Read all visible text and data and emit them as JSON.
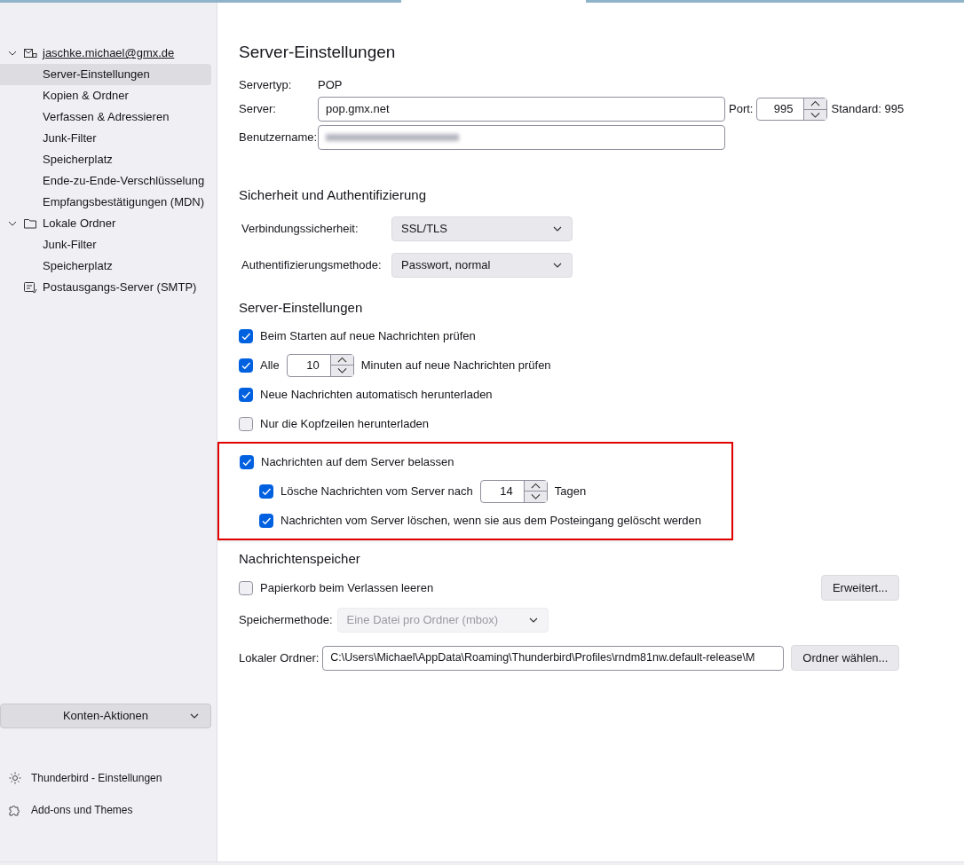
{
  "sidebar": {
    "accounts": [
      {
        "kind": "mail",
        "label": "jaschke.michael@gmx.de",
        "expanded": true,
        "children": [
          {
            "label": "Server-Einstellungen",
            "selected": true
          },
          {
            "label": "Kopien & Ordner",
            "selected": false
          },
          {
            "label": "Verfassen & Adressieren",
            "selected": false
          },
          {
            "label": "Junk-Filter",
            "selected": false
          },
          {
            "label": "Speicherplatz",
            "selected": false
          },
          {
            "label": "Ende-zu-Ende-Verschlüsselung",
            "selected": false
          },
          {
            "label": "Empfangsbestätigungen (MDN)",
            "selected": false
          }
        ]
      },
      {
        "kind": "folder",
        "label": "Lokale Ordner",
        "expanded": true,
        "children": [
          {
            "label": "Junk-Filter",
            "selected": false
          },
          {
            "label": "Speicherplatz",
            "selected": false
          }
        ]
      },
      {
        "kind": "outbox",
        "label": "Postausgangs-Server (SMTP)"
      }
    ],
    "actions_button": "Konten-Aktionen",
    "footer": [
      {
        "kind": "gear",
        "label": "Thunderbird - Einstellungen"
      },
      {
        "kind": "puzzle",
        "label": "Add-ons und Themes"
      }
    ]
  },
  "main": {
    "title": "Server-Einstellungen",
    "server_type": {
      "label": "Servertyp:",
      "value": "POP"
    },
    "server": {
      "label": "Server:",
      "value": "pop.gmx.net"
    },
    "port": {
      "label": "Port:",
      "value": "995",
      "default": "Standard: 995"
    },
    "username": {
      "label": "Benutzername:",
      "blurred": true
    },
    "security": {
      "title": "Sicherheit und Authentifizierung",
      "fields": [
        {
          "label": "Verbindungssicherheit:",
          "value": "SSL/TLS"
        },
        {
          "label": "Authentifizierungsmethode:",
          "value": "Passwort, normal"
        }
      ]
    },
    "settings": {
      "title": "Server-Einstellungen",
      "options": [
        {
          "kind": "plain",
          "label": "Beim Starten auf neue Nachrichten prüfen",
          "checked": true,
          "highlighted": false
        },
        {
          "kind": "spin",
          "label": "Alle",
          "value": "10",
          "suffix": "Minuten auf neue Nachrichten prüfen",
          "checked": true,
          "highlighted": false
        },
        {
          "kind": "plain",
          "label": "Neue Nachrichten automatisch herunterladen",
          "checked": true,
          "highlighted": false
        },
        {
          "kind": "plain",
          "label": "Nur die Kopfzeilen herunterladen",
          "checked": false,
          "highlighted": false
        },
        {
          "kind": "plain",
          "label": "Nachrichten auf dem Server belassen",
          "checked": true,
          "highlighted": true,
          "children": [
            {
              "kind": "spin",
              "label": "Lösche Nachrichten vom Server nach",
              "value": "14",
              "suffix": "Tagen",
              "checked": true
            },
            {
              "kind": "plain",
              "label": "Nachrichten vom Server löschen, wenn sie aus dem Posteingang gelöscht werden",
              "checked": true
            }
          ]
        }
      ]
    },
    "storage": {
      "title": "Nachrichtenspeicher",
      "empty_trash": {
        "label": "Papierkorb beim Verlassen leeren",
        "checked": false
      },
      "advanced_button": "Erweitert...",
      "method": {
        "label": "Speichermethode:",
        "value": "Eine Datei pro Ordner (mbox)",
        "disabled": true
      },
      "local_folder": {
        "label": "Lokaler Ordner:",
        "value": "C:\\Users\\Michael\\AppData\\Roaming\\Thunderbird\\Profiles\\rndm81nw.default-release\\M"
      },
      "choose_button": "Ordner wählen..."
    }
  }
}
